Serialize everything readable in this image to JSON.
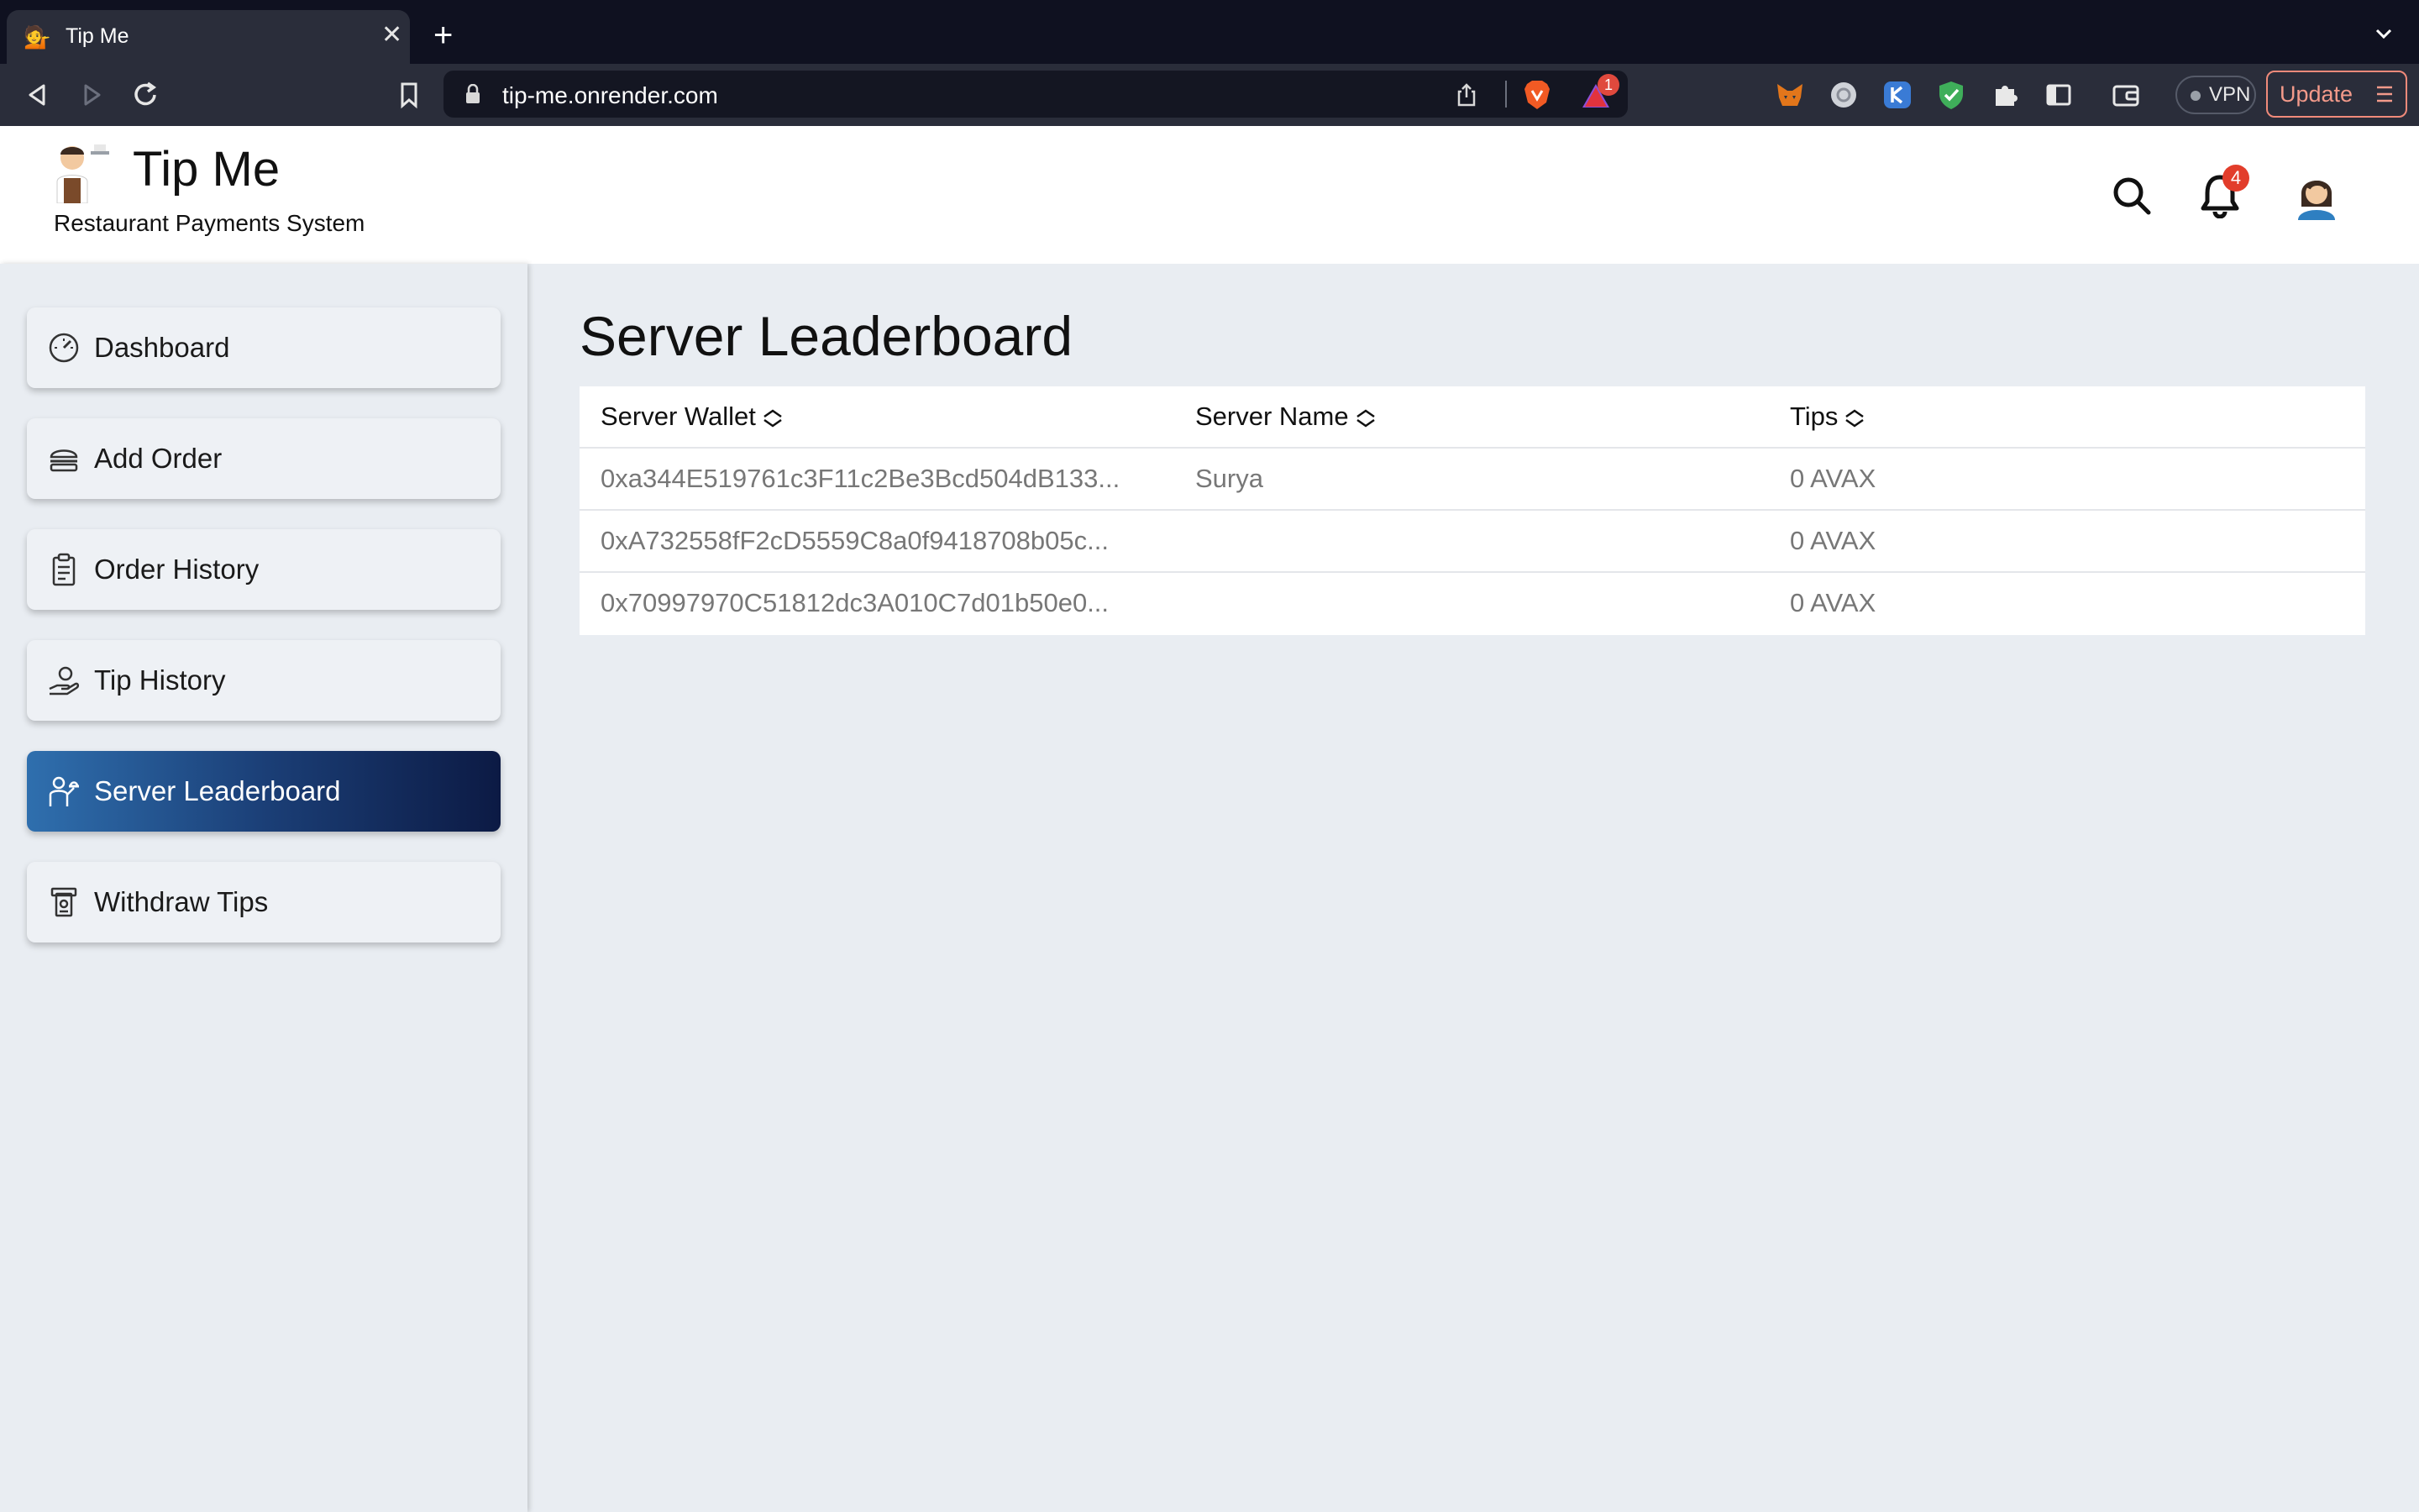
{
  "browser": {
    "tab_title": "Tip Me",
    "url": "tip-me.onrender.com",
    "rewards_badge": "1",
    "vpn_label": "VPN",
    "update_label": "Update"
  },
  "header": {
    "brand_name": "Tip Me",
    "tagline": "Restaurant Payments System",
    "notification_count": "4"
  },
  "sidebar": {
    "items": [
      {
        "label": "Dashboard",
        "icon": "speedometer-icon",
        "active": false
      },
      {
        "label": "Add Order",
        "icon": "burger-icon",
        "active": false
      },
      {
        "label": "Order History",
        "icon": "clipboard-icon",
        "active": false
      },
      {
        "label": "Tip History",
        "icon": "hand-coin-icon",
        "active": false
      },
      {
        "label": "Server Leaderboard",
        "icon": "waiter-icon",
        "active": true
      },
      {
        "label": "Withdraw Tips",
        "icon": "cash-withdraw-icon",
        "active": false
      }
    ]
  },
  "main": {
    "title": "Server Leaderboard",
    "table": {
      "columns": [
        "Server Wallet",
        "Server Name",
        "Tips"
      ],
      "rows": [
        {
          "wallet": "0xa344E519761c3F11c2Be3Bcd504dB133...",
          "name": "Surya",
          "tips": "0 AVAX"
        },
        {
          "wallet": "0xA732558fF2cD5559C8a0f9418708b05c...",
          "name": "",
          "tips": "0 AVAX"
        },
        {
          "wallet": "0x70997970C51812dc3A010C7d01b50e0...",
          "name": "",
          "tips": "0 AVAX"
        }
      ]
    }
  }
}
